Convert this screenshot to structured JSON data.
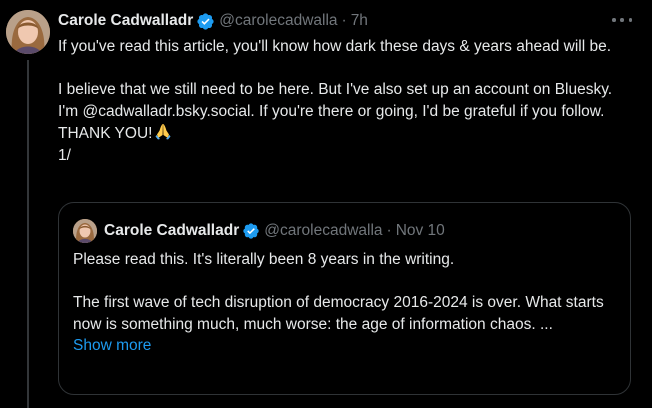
{
  "tweet": {
    "author_name": "Carole Cadwalladr",
    "handle": "@carolecadwalla",
    "separator": "·",
    "time": "7h",
    "lines": [
      "If you've read this article, you'll know how dark these days & years ahead will be.",
      "I believe that we still need to be here. But I've also set up an account on Bluesky. I'm @cadwalladr.bsky.social. If you're there or going, I'd be grateful if you follow. THANK YOU!",
      "1/"
    ],
    "emoji_name": "folded-hands-icon"
  },
  "quote": {
    "author_name": "Carole Cadwalladr",
    "handle": "@carolecadwalla",
    "separator": "·",
    "time": "Nov 10",
    "lines": [
      "Please read this. It's literally been 8 years in the writing.",
      "The first wave of tech disruption of democracy 2016-2024 is over. What starts now is something much, much worse: the age of information chaos. ..."
    ],
    "show_more": "Show more"
  },
  "colors": {
    "background": "#000000",
    "text": "#e7e9ea",
    "muted": "#71767b",
    "link": "#1d9bf0",
    "verified": "#1d9bf0",
    "border": "#2f3336"
  }
}
